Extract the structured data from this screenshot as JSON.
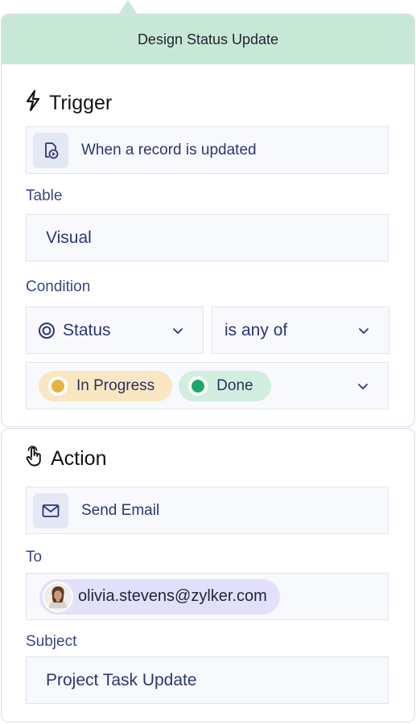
{
  "header": {
    "title": "Design Status Update"
  },
  "trigger": {
    "heading": "Trigger",
    "event": "When a record is updated",
    "table_label": "Table",
    "table_value": "Visual",
    "condition_label": "Condition",
    "condition_field": "Status",
    "condition_operator": "is any of",
    "values": [
      {
        "label": "In Progress",
        "bg": "#f8e7c2",
        "dot": "#e6b33d"
      },
      {
        "label": "Done",
        "bg": "#d1eee0",
        "dot": "#1aa86b"
      }
    ]
  },
  "action": {
    "heading": "Action",
    "type": "Send Email",
    "to_label": "To",
    "to_value": "olivia.stevens@zylker.com",
    "subject_label": "Subject",
    "subject_value": "Project Task Update"
  },
  "colors": {
    "header_bg": "#c8e8d7",
    "text_accent": "#2b3673",
    "recipient_chip_bg": "#e3e0fb"
  },
  "icons": {
    "trigger": "lightning-icon",
    "event": "record-updated-icon",
    "condition_field": "status-icon",
    "action": "hand-pointer-icon",
    "action_type": "envelope-icon"
  }
}
